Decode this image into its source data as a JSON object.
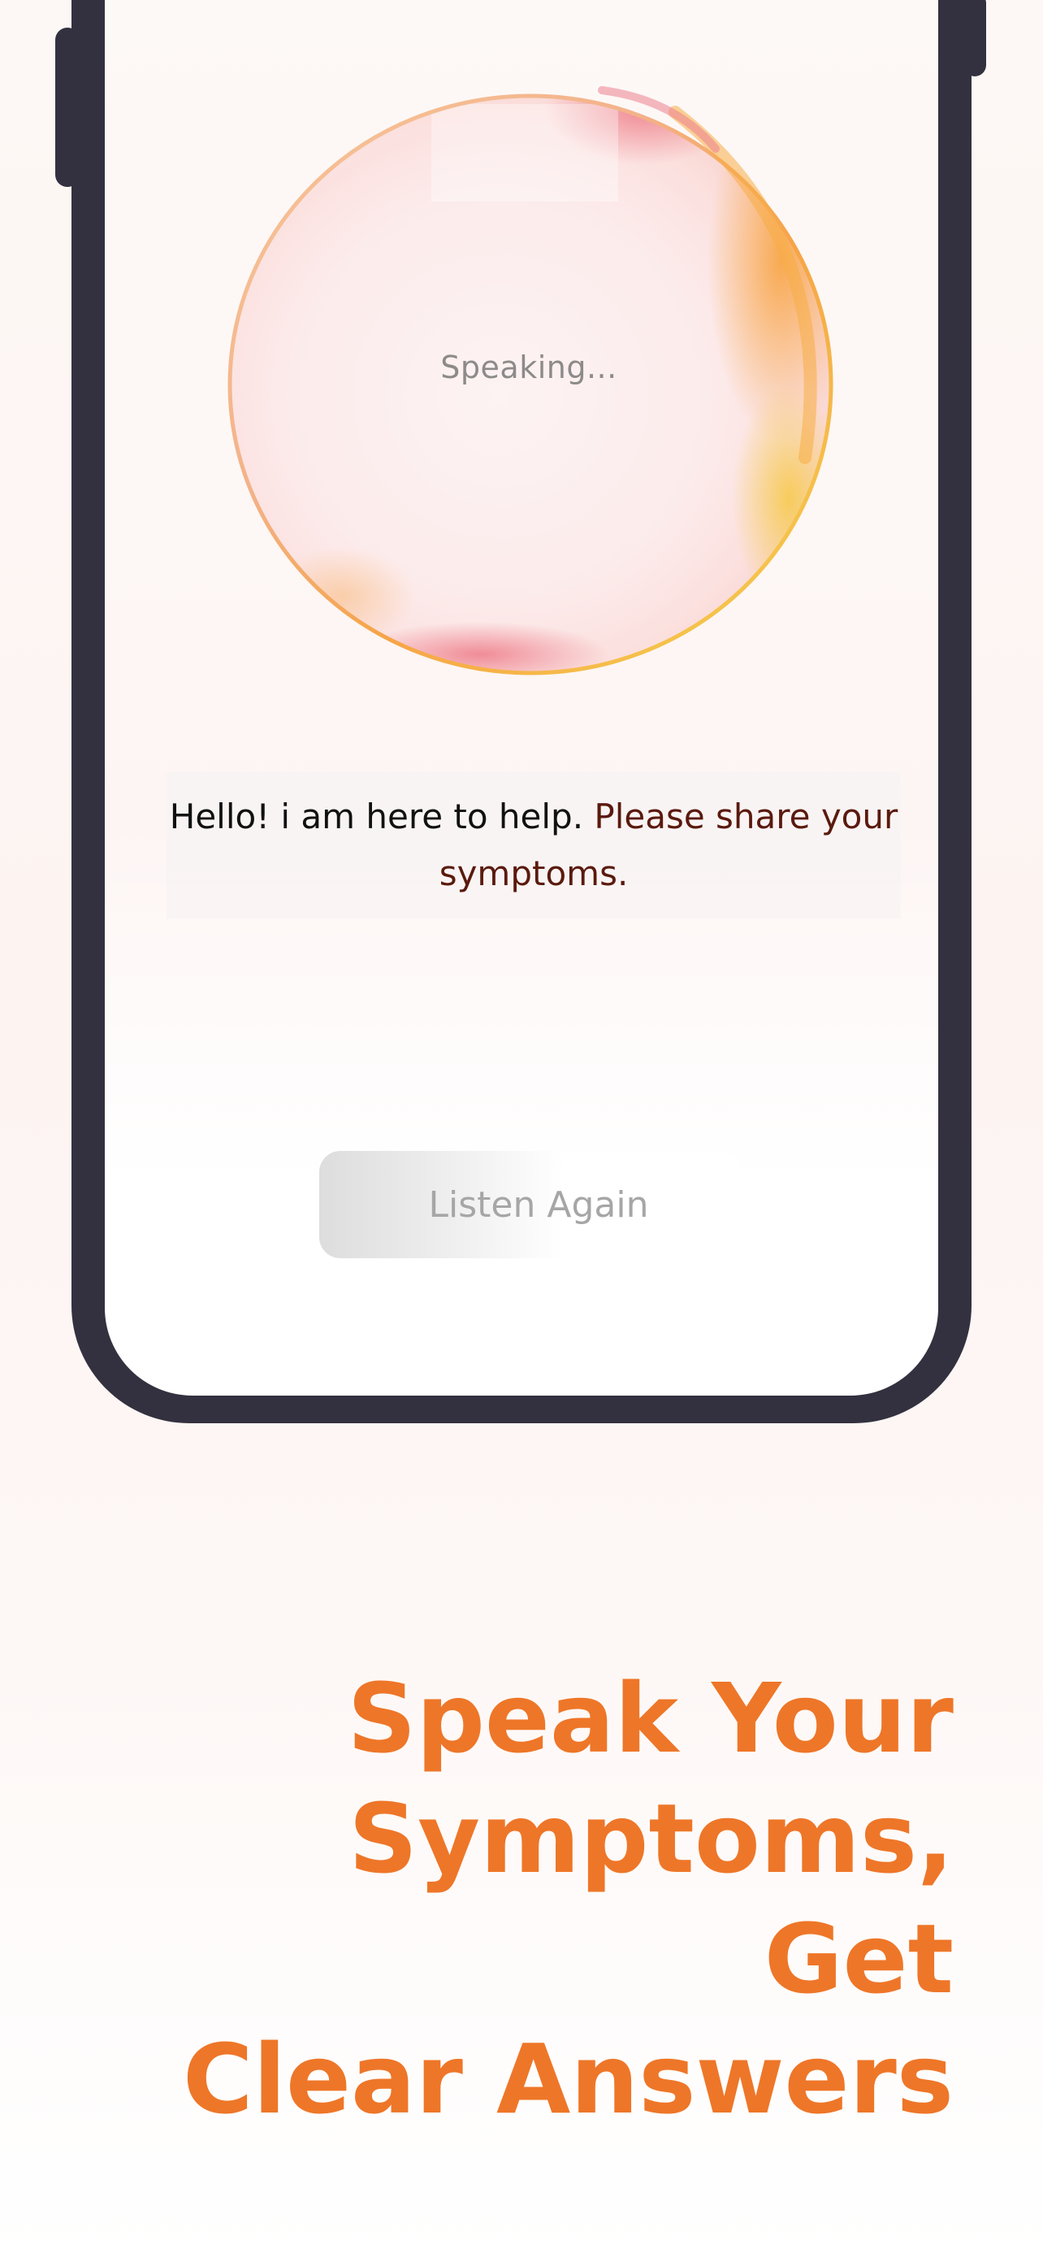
{
  "orb": {
    "status_text": "Speaking..."
  },
  "message": {
    "part1": "Hello! i am here to help.",
    "part2": "Please share your symptoms."
  },
  "listen_button": {
    "label": "Listen Again"
  },
  "headline": {
    "line1": "Speak Your",
    "line2": "Symptoms, Get",
    "line3": "Clear Answers"
  },
  "colors": {
    "headline": "#ee7628",
    "phone_frame": "#33313f",
    "message_accent": "#5a1a0d",
    "orb_orange": "#f5a43a",
    "orb_pink": "#ec6f7e"
  }
}
